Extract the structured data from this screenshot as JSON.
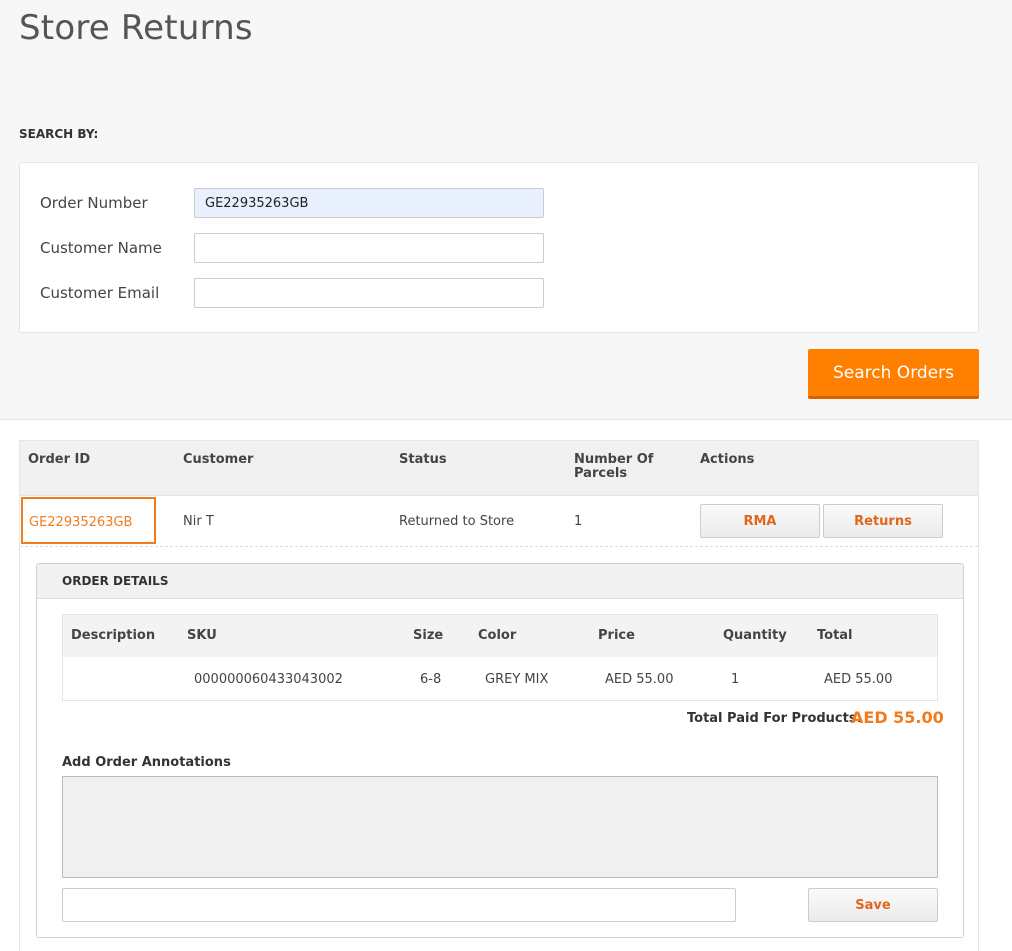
{
  "page": {
    "title": "Store Returns"
  },
  "search": {
    "section_label": "SEARCH BY:",
    "fields": [
      {
        "label": "Order Number",
        "value": "GE22935263GB",
        "placeholder": ""
      },
      {
        "label": "Customer Name",
        "value": "",
        "placeholder": ""
      },
      {
        "label": "Customer Email",
        "value": "",
        "placeholder": ""
      }
    ],
    "button_label": "Search Orders"
  },
  "results": {
    "columns": [
      "Order ID",
      "Customer",
      "Status",
      "Number Of Parcels",
      "Actions"
    ],
    "rows": [
      {
        "order_id": "GE22935263GB",
        "customer": "Nir T",
        "status": "Returned to Store",
        "parcels": "1",
        "actions": [
          "RMA",
          "Returns"
        ]
      }
    ]
  },
  "order_details": {
    "title": "ORDER DETAILS",
    "columns": [
      "Description",
      "SKU",
      "Size",
      "Color",
      "Price",
      "Quantity",
      "Total"
    ],
    "items": [
      {
        "description": "",
        "sku": "000000060433043002",
        "size": "6-8",
        "color": "GREY MIX",
        "price": "AED 55.00",
        "quantity": "1",
        "total": "AED 55.00"
      }
    ],
    "total_label": "Total Paid For Products:",
    "total_value": "AED 55.00",
    "annotations_label": "Add Order Annotations",
    "annotations_text": "",
    "annotation_input": "",
    "save_label": "Save"
  },
  "colors": {
    "accent": "#ff7f00",
    "link": "#f07c1e",
    "action_text": "#e0661b"
  }
}
